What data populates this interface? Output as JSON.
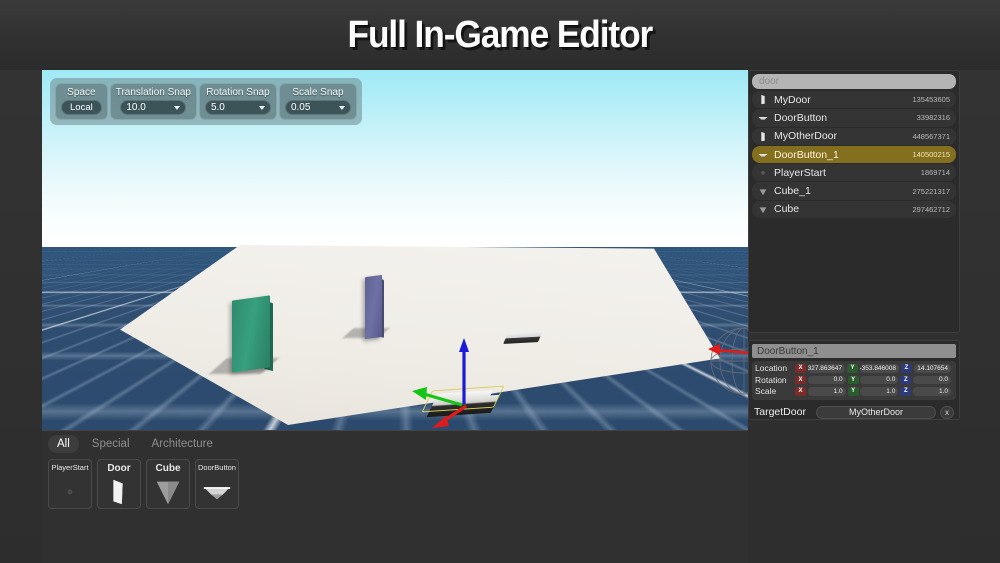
{
  "title": "Full In-Game Editor",
  "viewport": {
    "toolbar": {
      "space": {
        "label": "Space",
        "value": "Local"
      },
      "translation_snap": {
        "label": "Translation Snap",
        "value": "10.0"
      },
      "rotation_snap": {
        "label": "Rotation Snap",
        "value": "5.0"
      },
      "scale_snap": {
        "label": "Scale Snap",
        "value": "0.05"
      }
    }
  },
  "outliner": {
    "search_text": "door",
    "rows": [
      {
        "name": "MyDoor",
        "id": "135453605",
        "icon": "door-icon",
        "selected": false
      },
      {
        "name": "DoorButton",
        "id": "33982316",
        "icon": "button-icon",
        "selected": false
      },
      {
        "name": "MyOtherDoor",
        "id": "448567371",
        "icon": "door-icon",
        "selected": false
      },
      {
        "name": "DoorButton_1",
        "id": "140500215",
        "icon": "button-icon",
        "selected": true
      },
      {
        "name": "PlayerStart",
        "id": "1869714",
        "icon": "player-icon",
        "selected": false
      },
      {
        "name": "Cube_1",
        "id": "275221317",
        "icon": "cube-icon",
        "selected": false
      },
      {
        "name": "Cube",
        "id": "297462712",
        "icon": "cube-icon",
        "selected": false
      }
    ]
  },
  "properties": {
    "object_name": "DoorButton_1",
    "transform": [
      {
        "label": "Location",
        "x": "327.863647",
        "y": "-353.846008",
        "z": "14.107654"
      },
      {
        "label": "Rotation",
        "x": "0.0",
        "y": "0.0",
        "z": "0.0"
      },
      {
        "label": "Scale",
        "x": "1.0",
        "y": "1.0",
        "z": "1.0"
      }
    ],
    "axis_labels": {
      "x": "X",
      "y": "Y",
      "z": "Z"
    },
    "target_door": {
      "label": "TargetDoor",
      "value": "MyOtherDoor",
      "clear": "x"
    }
  },
  "palette": {
    "tabs": [
      {
        "label": "All",
        "active": true
      },
      {
        "label": "Special",
        "active": false
      },
      {
        "label": "Architecture",
        "active": false
      }
    ],
    "assets": [
      {
        "name": "PlayerStart",
        "icon": "player-start-thumb",
        "size": "small"
      },
      {
        "name": "Door",
        "icon": "door-thumb",
        "size": "big"
      },
      {
        "name": "Cube",
        "icon": "cube-thumb",
        "size": "big"
      },
      {
        "name": "DoorButton",
        "icon": "door-button-thumb",
        "size": "small"
      }
    ]
  },
  "colors": {
    "selection": "#836f1d",
    "axis_x": "#7d2a2a",
    "axis_y": "#2a5c2d",
    "axis_z": "#2f3a78",
    "gizmo_x": "#e01b1b",
    "gizmo_y": "#16c416",
    "gizmo_z": "#1a1ad8",
    "panel_bg": "#2b2b2b"
  }
}
